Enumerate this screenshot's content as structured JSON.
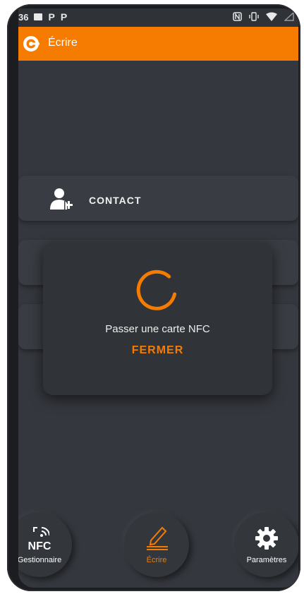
{
  "status_bar": {
    "time": "36",
    "left_icons": [
      "image-icon",
      "parking-icon",
      "parking-icon"
    ],
    "right_icons": [
      "nfc-icon",
      "vibrate-icon",
      "wifi-icon",
      "signal-icon"
    ],
    "p1": "P",
    "p2": "P"
  },
  "app_bar": {
    "title": "Écrire",
    "color": "#f57c00"
  },
  "menu": {
    "contact_label": "CONTACT"
  },
  "dialog": {
    "message": "Passer une carte NFC",
    "close_label": "FERMER"
  },
  "bottom_nav": {
    "gestionnaire": {
      "badge": "NFC",
      "label": "Gestionnaire"
    },
    "ecrire": {
      "label": "Écrire"
    },
    "parametres": {
      "label": "Paramètres"
    }
  },
  "colors": {
    "accent": "#f57c00",
    "background": "#34373d"
  }
}
